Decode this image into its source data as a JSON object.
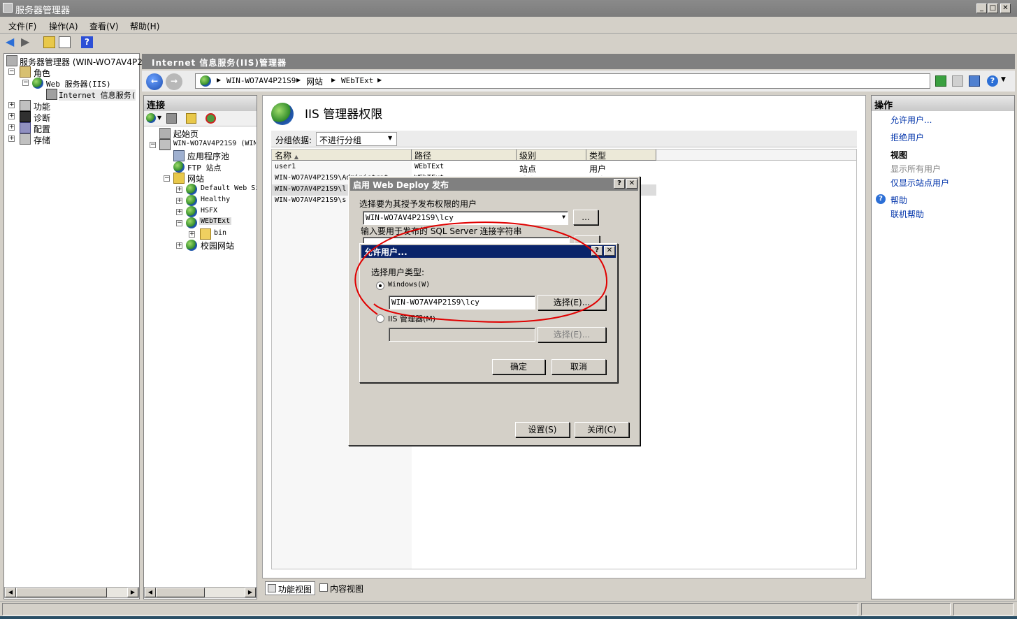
{
  "window": {
    "title": "服务器管理器"
  },
  "menu": [
    "文件(F)",
    "操作(A)",
    "查看(V)",
    "帮助(H)"
  ],
  "left_tree": {
    "root": "服务器管理器 (WIN-WO7AV4P21S",
    "items": [
      "角色",
      "Web 服务器(IIS)",
      "Internet 信息服务(",
      "功能",
      "诊断",
      "配置",
      "存储"
    ]
  },
  "iis": {
    "header": "Internet 信息服务(IIS)管理器",
    "breadcrumb": [
      "WIN-WO7AV4P21S9",
      "网站",
      "WEbTExt"
    ]
  },
  "connections": {
    "title": "连接",
    "items": [
      "起始页",
      "WIN-WO7AV4P21S9 (WIN",
      "应用程序池",
      "FTP 站点",
      "网站",
      "Default Web Si",
      "Healthy",
      "HSFX",
      "WEbTExt",
      "bin",
      "校园网站"
    ]
  },
  "content": {
    "title": "IIS 管理器权限",
    "group_label": "分组依据:",
    "group_value": "不进行分组",
    "columns": [
      "名称",
      "路径",
      "级别",
      "类型"
    ],
    "rows": [
      [
        "user1",
        "WEbTExt",
        "站点",
        "用户"
      ],
      [
        "WIN-WO7AV4P21S9\\Administrat",
        "WEbTExt",
        "站点",
        "用户"
      ],
      [
        "WIN-WO7AV4P21S9\\l",
        "",
        "",
        ""
      ],
      [
        "WIN-WO7AV4P21S9\\s",
        "",
        "",
        ""
      ]
    ]
  },
  "view_tabs": [
    "功能视图",
    "内容视图"
  ],
  "actions": {
    "title": "操作",
    "items": [
      "允许用户...",
      "拒绝用户"
    ],
    "view_title": "视图",
    "view_items": [
      "显示所有用户",
      "仅显示站点用户"
    ],
    "help_items": [
      "帮助",
      "联机帮助"
    ]
  },
  "deploy_dialog": {
    "title": "启用 Web Deploy 发布",
    "user_label": "选择要为其授予发布权限的用户",
    "user_value": "WIN-WO7AV4P21S9\\lcy",
    "browse": "...",
    "sql_label": "输入要用于发布的 SQL Server 连接字符串",
    "setup": "设置(S)",
    "close": "关闭(C)"
  },
  "allow_dialog": {
    "title": "允许用户...",
    "type_label": "选择用户类型:",
    "windows": "Windows(W)",
    "windows_value": "WIN-WO7AV4P21S9\\lcy",
    "select1": "选择(E)...",
    "iis_manager": "IIS 管理器(M)",
    "select2": "选择(E)...",
    "ok": "确定",
    "cancel": "取消"
  },
  "colors": {
    "accent": "#0a246a",
    "annotation": "#e00000"
  }
}
